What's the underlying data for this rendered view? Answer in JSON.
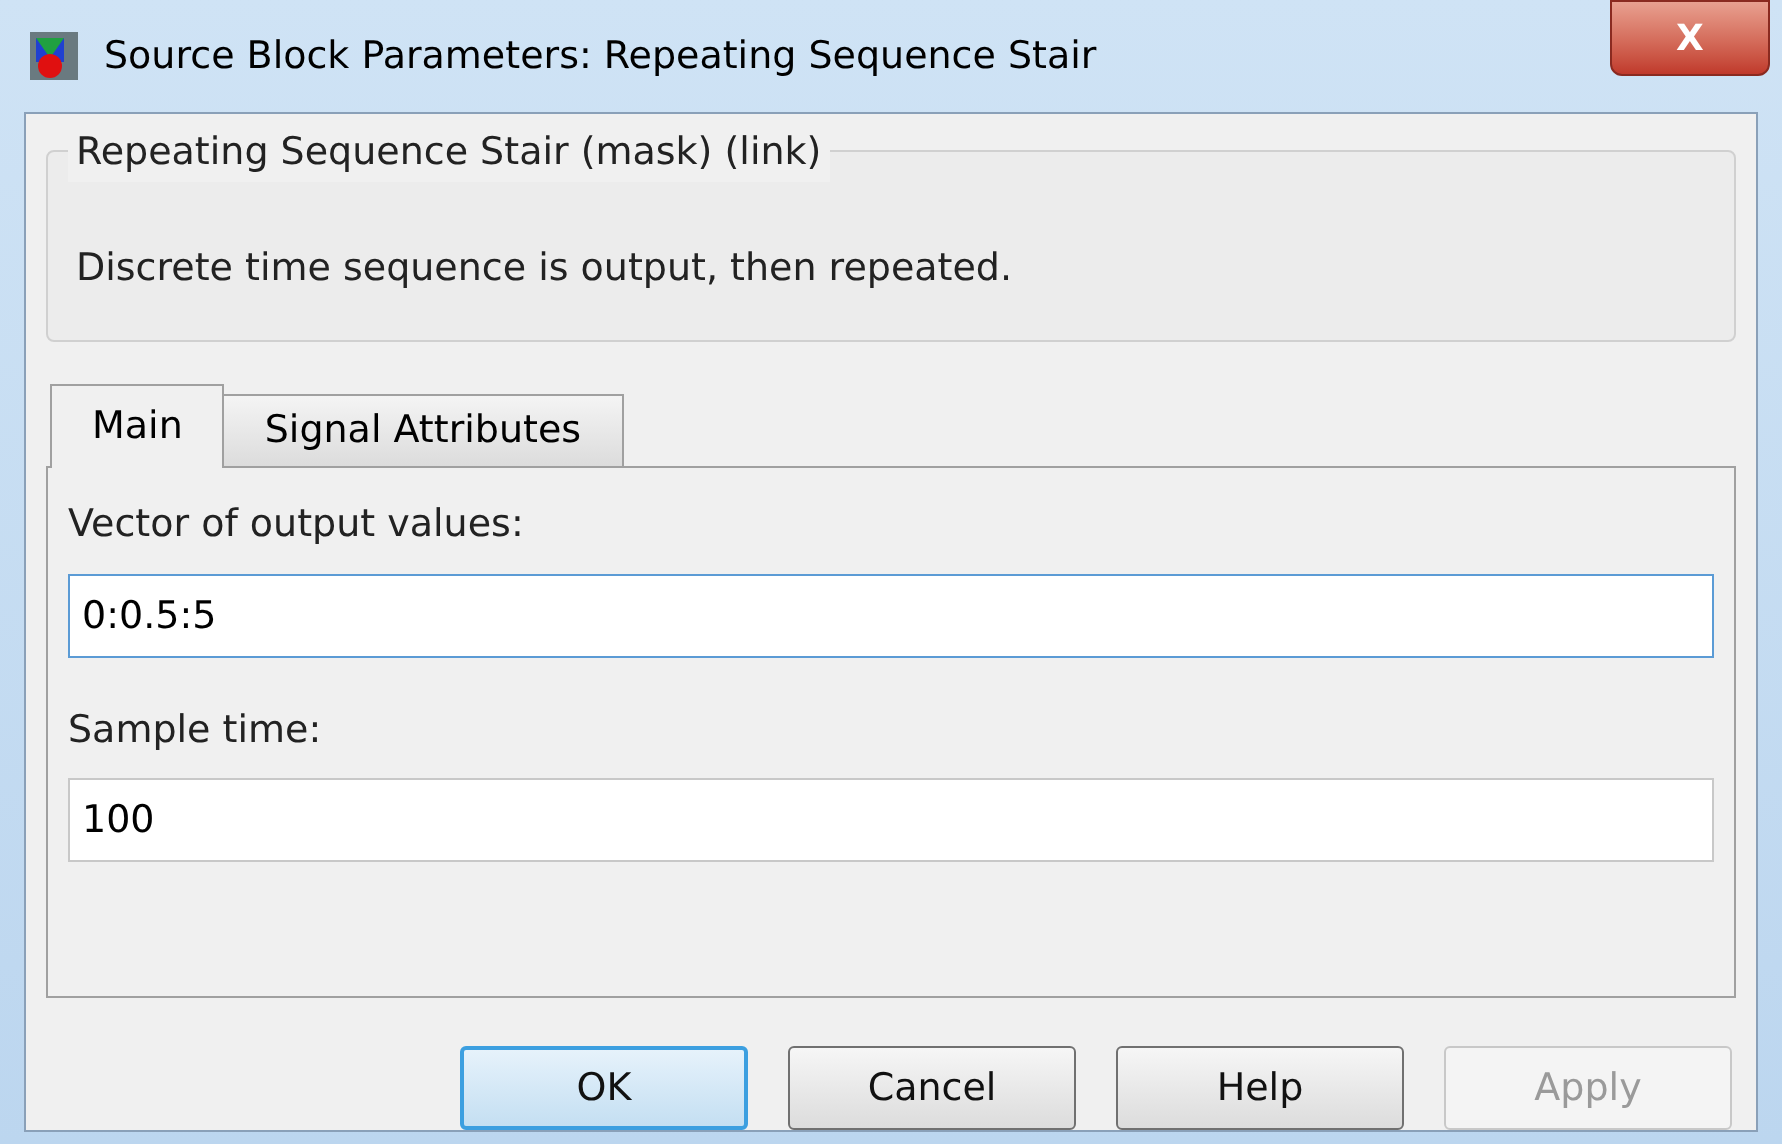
{
  "window": {
    "title": "Source Block Parameters: Repeating Sequence Stair",
    "close": "X"
  },
  "group": {
    "title": "Repeating Sequence Stair (mask) (link)",
    "description": "Discrete time sequence is output, then repeated."
  },
  "tabs": [
    {
      "label": "Main",
      "selected": true
    },
    {
      "label": "Signal Attributes",
      "selected": false
    }
  ],
  "fields": [
    {
      "label": "Vector of output values:",
      "value": "0:0.5:5",
      "focused": true
    },
    {
      "label": "Sample time:",
      "value": "100",
      "focused": false
    }
  ],
  "buttons": [
    {
      "label": "OK",
      "default": true,
      "disabled": false
    },
    {
      "label": "Cancel",
      "default": false,
      "disabled": false
    },
    {
      "label": "Help",
      "default": false,
      "disabled": false
    },
    {
      "label": "Apply",
      "default": false,
      "disabled": true
    }
  ]
}
